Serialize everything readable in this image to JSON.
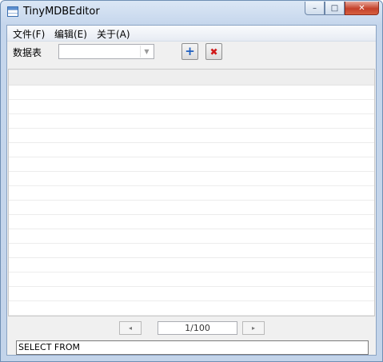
{
  "window": {
    "title": "TinyMDBEditor"
  },
  "window_buttons": {
    "minimize": "–",
    "maximize": "□",
    "close": "✕"
  },
  "menu": [
    {
      "label": "文件(F)"
    },
    {
      "label": "编辑(E)"
    },
    {
      "label": "关于(A)"
    }
  ],
  "toolbar": {
    "table_label": "数据表",
    "table_select_value": "",
    "add_glyph": "+",
    "delete_glyph": "✖"
  },
  "pager": {
    "prev_glyph": "◂",
    "page_text": "1/100",
    "next_glyph": "▸"
  },
  "sql": {
    "value": "SELECT FROM"
  },
  "colors": {
    "add": "#1f5fbf",
    "delete": "#d11a1a"
  }
}
